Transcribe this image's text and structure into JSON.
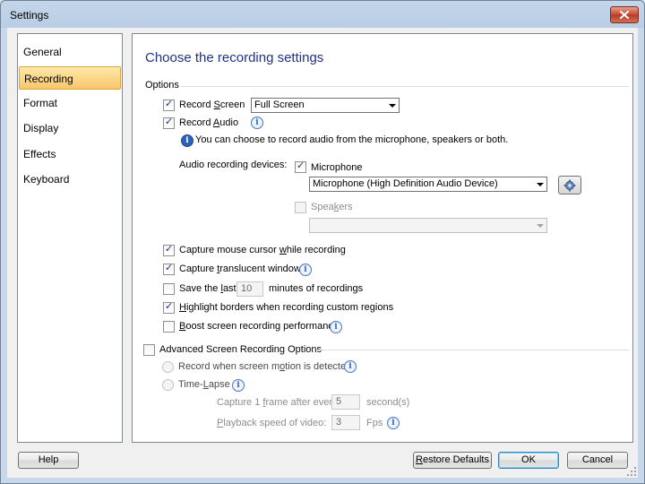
{
  "window": {
    "title": "Settings"
  },
  "nav": {
    "items": [
      "General",
      "Recording",
      "Format",
      "Display",
      "Effects",
      "Keyboard"
    ],
    "selected": "Recording"
  },
  "panel": {
    "heading": "Choose the recording settings",
    "options_label": "Options",
    "record_screen": {
      "pre": "Record ",
      "accel": "S",
      "post": "creen",
      "checked": true,
      "select_value": "Full Screen"
    },
    "record_audio": {
      "pre": "Record ",
      "accel": "A",
      "post": "udio",
      "checked": true
    },
    "audio_info_text": "You can choose to record audio from the microphone, speakers or both.",
    "audio_devices_label": "Audio recording devices:",
    "microphone": {
      "label": "Microphone",
      "checked": true,
      "select_value": "Microphone (High Definition Audio Device)"
    },
    "speakers": {
      "pre": "Spea",
      "accel": "k",
      "post": "ers",
      "checked": false,
      "select_value": ""
    },
    "capture_cursor": {
      "pre": "Capture mouse cursor ",
      "accel": "w",
      "post": "hile recording",
      "checked": true
    },
    "capture_translucent": {
      "pre": "Capture ",
      "accel": "t",
      "post": "ranslucent windows",
      "checked": true
    },
    "save_last": {
      "pre": "Save the ",
      "accel": "l",
      "post": "ast",
      "value": "10",
      "suffix": "minutes of recordings",
      "checked": false
    },
    "highlight_borders": {
      "pre": "",
      "accel": "H",
      "post": "ighlight borders when recording custom regions",
      "checked": true
    },
    "boost": {
      "pre": "",
      "accel": "B",
      "post": "oost screen recording performance",
      "checked": false
    },
    "advanced": {
      "label": "Advanced Screen Recording Options",
      "checked": false
    },
    "record_motion": {
      "pre": "Record when screen m",
      "accel": "o",
      "post": "tion is detected"
    },
    "time_lapse": {
      "pre": "Time-",
      "accel": "L",
      "post": "apse"
    },
    "capture_frame": {
      "pre": "Capture 1 ",
      "accel": "f",
      "post": "rame after every",
      "value": "5",
      "suffix": "second(s)"
    },
    "playback_speed": {
      "pre": "",
      "accel": "P",
      "post": "layback speed of video:",
      "value": "3",
      "suffix": "Fps"
    }
  },
  "buttons": {
    "help": "Help",
    "restore_pre": "",
    "restore_accel": "R",
    "restore_post": "estore Defaults",
    "ok": "OK",
    "cancel": "Cancel"
  },
  "colors": {
    "heading": "#1e3287",
    "nav_selected": "#f8c66a",
    "info_icon": "#2d62b8"
  }
}
